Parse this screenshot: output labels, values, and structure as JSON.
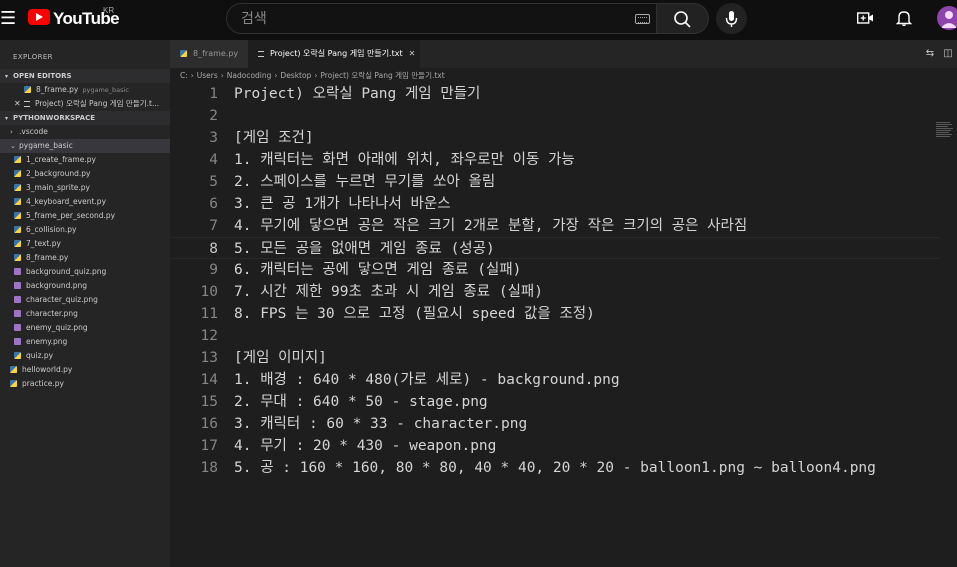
{
  "youtube": {
    "wordmark": "YouTube",
    "region": "KR",
    "search_placeholder": "검색"
  },
  "explorer": {
    "title": "EXPLORER",
    "open_editors_label": "OPEN EDITORS",
    "open_editors": [
      {
        "name": "8_frame.py",
        "desc": "pygame_basic",
        "type": "py"
      },
      {
        "name": "Project) 오락실 Pang 게임 만들기.t...",
        "desc": "",
        "type": "txt",
        "active": true
      }
    ],
    "workspace_label": "PYTHONWORKSPACE",
    "tree": [
      {
        "name": ".vscode",
        "kind": "folder-collapsed",
        "indent": 1
      },
      {
        "name": "pygame_basic",
        "kind": "folder-open",
        "indent": 1
      },
      {
        "name": "1_create_frame.py",
        "kind": "py",
        "indent": 2
      },
      {
        "name": "2_background.py",
        "kind": "py",
        "indent": 2
      },
      {
        "name": "3_main_sprite.py",
        "kind": "py",
        "indent": 2
      },
      {
        "name": "4_keyboard_event.py",
        "kind": "py",
        "indent": 2
      },
      {
        "name": "5_frame_per_second.py",
        "kind": "py",
        "indent": 2
      },
      {
        "name": "6_collision.py",
        "kind": "py",
        "indent": 2
      },
      {
        "name": "7_text.py",
        "kind": "py",
        "indent": 2
      },
      {
        "name": "8_frame.py",
        "kind": "py",
        "indent": 2
      },
      {
        "name": "background_quiz.png",
        "kind": "png",
        "indent": 2
      },
      {
        "name": "background.png",
        "kind": "png",
        "indent": 2
      },
      {
        "name": "character_quiz.png",
        "kind": "png",
        "indent": 2
      },
      {
        "name": "character.png",
        "kind": "png",
        "indent": 2
      },
      {
        "name": "enemy_quiz.png",
        "kind": "png",
        "indent": 2
      },
      {
        "name": "enemy.png",
        "kind": "png",
        "indent": 2
      },
      {
        "name": "quiz.py",
        "kind": "py",
        "indent": 2
      },
      {
        "name": "helloworld.py",
        "kind": "py",
        "indent": 1
      },
      {
        "name": "practice.py",
        "kind": "py",
        "indent": 1
      }
    ]
  },
  "tabs": [
    {
      "label": "8_frame.py",
      "type": "py",
      "active": false
    },
    {
      "label": "Project) 오락실 Pang 게임 만들기.txt",
      "type": "txt",
      "active": true
    }
  ],
  "breadcrumb": [
    "C:",
    "Users",
    "Nadocoding",
    "Desktop",
    "Project) 오락실 Pang 게임 만들기.txt"
  ],
  "editor": {
    "current_line": 8,
    "lines": [
      "Project) 오락실 Pang 게임 만들기",
      "",
      "[게임 조건]",
      "1. 캐릭터는 화면 아래에 위치, 좌우로만 이동 가능",
      "2. 스페이스를 누르면 무기를 쏘아 올림",
      "3. 큰 공 1개가 나타나서 바운스",
      "4. 무기에 닿으면 공은 작은 크기 2개로 분할, 가장 작은 크기의 공은 사라짐",
      "5. 모든 공을 없애면 게임 종료 (성공)",
      "6. 캐릭터는 공에 닿으면 게임 종료 (실패)",
      "7. 시간 제한 99초 초과 시 게임 종료 (실패)",
      "8. FPS 는 30 으로 고정 (필요시 speed 값을 조정)",
      "",
      "[게임 이미지]",
      "1. 배경 : 640 * 480(가로 세로) - background.png",
      "2. 무대 : 640 * 50 - stage.png",
      "3. 캐릭터 : 60 * 33 - character.png",
      "4. 무기 : 20 * 430 - weapon.png",
      "5. 공 : 160 * 160, 80 * 80, 40 * 40, 20 * 20 - balloon1.png ~ balloon4.png"
    ]
  },
  "colors": {
    "editor_bg": "#1e1e1e",
    "sidebar_bg": "#252526",
    "youtube_red": "#ff0000",
    "selection": "#264f78"
  }
}
